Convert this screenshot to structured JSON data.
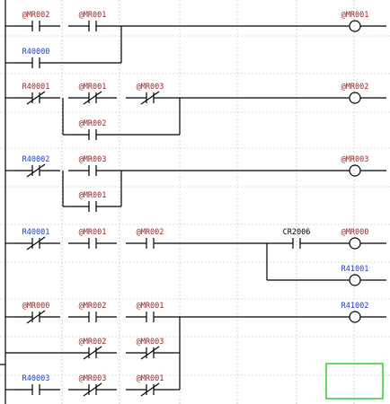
{
  "colors": {
    "device_label_internal": "#9b1c1c",
    "device_label_io": "#1a3cc8",
    "wire": "#000000",
    "grid": "#c9c9c9",
    "cursor": "#33cc33"
  },
  "rungs": [
    {
      "elements": [
        {
          "kind": "no-contact",
          "label": "@MR002",
          "color": "red"
        },
        {
          "kind": "no-contact",
          "label": "@MR001",
          "color": "red"
        },
        {
          "kind": "branch-contact",
          "label": "R40000",
          "color": "blue",
          "type": "no"
        },
        {
          "kind": "coil",
          "label": "@MR001",
          "color": "red"
        }
      ]
    },
    {
      "elements": [
        {
          "kind": "nc-contact",
          "label": "R40001",
          "color": "red"
        },
        {
          "kind": "nc-contact",
          "label": "@MR001",
          "color": "red"
        },
        {
          "kind": "nc-contact",
          "label": "@MR003",
          "color": "red"
        },
        {
          "kind": "branch-contact",
          "label": "@MR002",
          "color": "red",
          "type": "no"
        },
        {
          "kind": "coil",
          "label": "@MR002",
          "color": "red"
        }
      ]
    },
    {
      "elements": [
        {
          "kind": "nc-contact",
          "label": "R40002",
          "color": "blue"
        },
        {
          "kind": "no-contact",
          "label": "@MR003",
          "color": "red"
        },
        {
          "kind": "branch-contact",
          "label": "@MR001",
          "color": "red",
          "type": "no"
        },
        {
          "kind": "coil",
          "label": "@MR003",
          "color": "red"
        }
      ]
    },
    {
      "elements": [
        {
          "kind": "nc-contact",
          "label": "R40001",
          "color": "blue"
        },
        {
          "kind": "no-contact",
          "label": "@MR001",
          "color": "red"
        },
        {
          "kind": "no-contact",
          "label": "@MR002",
          "color": "red"
        },
        {
          "kind": "no-contact",
          "label": "CR2006",
          "color": "black"
        },
        {
          "kind": "coil",
          "label": "@MR000",
          "color": "red"
        },
        {
          "kind": "coil",
          "label": "R41001",
          "color": "blue"
        }
      ]
    },
    {
      "elements": [
        {
          "kind": "nc-contact",
          "label": "@MR000",
          "color": "red"
        },
        {
          "kind": "no-contact",
          "label": "@MR002",
          "color": "red"
        },
        {
          "kind": "no-contact",
          "label": "@MR001",
          "color": "red"
        },
        {
          "kind": "coil",
          "label": "R41002",
          "color": "blue"
        },
        {
          "kind": "nc-contact",
          "label": "@MR002",
          "color": "red"
        },
        {
          "kind": "nc-contact",
          "label": "@MR003",
          "color": "red"
        },
        {
          "kind": "no-contact",
          "label": "R40003",
          "color": "blue"
        },
        {
          "kind": "nc-contact",
          "label": "@MR003",
          "color": "red"
        },
        {
          "kind": "nc-contact",
          "label": "@MR001",
          "color": "red"
        }
      ]
    }
  ]
}
